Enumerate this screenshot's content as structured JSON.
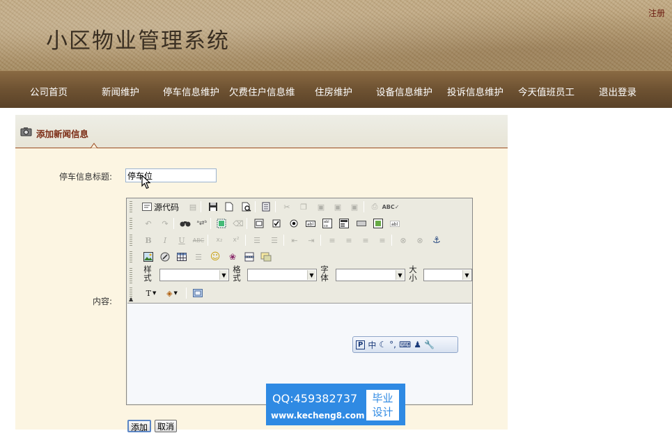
{
  "header": {
    "site_title": "小区物业管理系统",
    "register_link": "注册"
  },
  "nav": {
    "items": [
      {
        "label": "公司首页"
      },
      {
        "label": "新闻维护"
      },
      {
        "label": "停车信息维护"
      },
      {
        "label": "欠费住户信息维"
      },
      {
        "label": "住房维护"
      },
      {
        "label": "设备信息维护"
      },
      {
        "label": "投诉信息维护"
      },
      {
        "label": "今天值班员工"
      },
      {
        "label": "退出登录"
      }
    ]
  },
  "panel": {
    "title": "添加新闻信息",
    "title_field_label": "停车信息标题:",
    "title_field_value": "停车位",
    "content_label": "内容:"
  },
  "editor": {
    "source_button_label": "源代码",
    "combos": {
      "style_label": "样式",
      "format_label": "格式",
      "font_label": "字体",
      "size_label": "大小"
    },
    "ime_bar": {
      "p_label": "P",
      "mode": "中",
      "punct": "°,"
    },
    "toolbar_icons": [
      "source-icon",
      "save-icon",
      "new-page-icon",
      "preview-icon",
      "templates-icon",
      "cut-icon",
      "copy-icon",
      "paste-icon",
      "paste-text-icon",
      "paste-word-icon",
      "print-icon",
      "spellcheck-icon",
      "undo-icon",
      "redo-icon",
      "find-icon",
      "replace-icon",
      "select-all-icon",
      "remove-format-icon",
      "form-icon",
      "checkbox-icon",
      "radio-icon",
      "textfield-icon",
      "textarea-icon",
      "select-icon",
      "button-icon",
      "image-button-icon",
      "hidden-field-icon",
      "bold-icon",
      "italic-icon",
      "underline-icon",
      "strike-icon",
      "subscript-icon",
      "superscript-icon",
      "ordered-list-icon",
      "unordered-list-icon",
      "outdent-icon",
      "indent-icon",
      "align-left-icon",
      "align-center-icon",
      "align-right-icon",
      "justify-icon",
      "link-icon",
      "unlink-icon",
      "anchor-icon",
      "image-icon",
      "flash-icon",
      "table-icon",
      "rule-icon",
      "smiley-icon",
      "special-char-icon",
      "page-break-icon",
      "text-color-icon",
      "bg-color-icon",
      "show-blocks-icon"
    ]
  },
  "buttons": {
    "add": "添加",
    "cancel": "取消"
  },
  "watermark": {
    "qq": "QQ:459382737",
    "url": "www.kecheng8.com",
    "badge_line1": "毕业",
    "badge_line2": "设计"
  }
}
